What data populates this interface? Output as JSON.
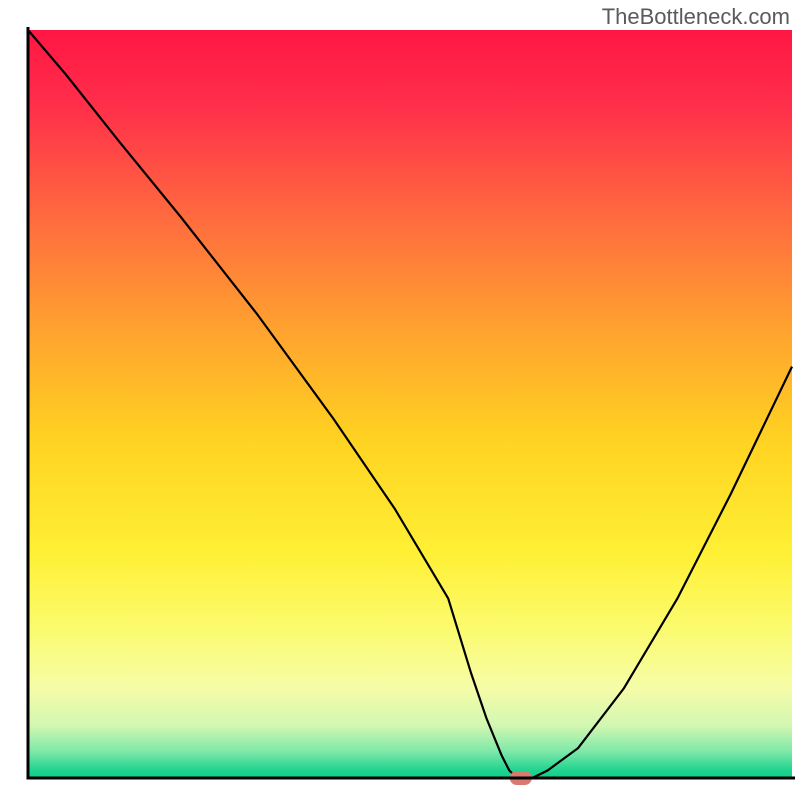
{
  "watermark": "TheBottleneck.com",
  "chart_data": {
    "type": "line",
    "title": "",
    "xlabel": "",
    "ylabel": "",
    "xlim": [
      0,
      100
    ],
    "ylim": [
      0,
      100
    ],
    "x": [
      0,
      5,
      12,
      20,
      30,
      40,
      48,
      55,
      58,
      60,
      62,
      63,
      64,
      66,
      68,
      72,
      78,
      85,
      92,
      100
    ],
    "values": [
      100,
      94,
      85,
      75,
      62,
      48,
      36,
      24,
      14,
      8,
      3,
      1,
      0,
      0,
      1,
      4,
      12,
      24,
      38,
      55
    ],
    "marker": {
      "x": 64.5,
      "y": 0,
      "color": "#d87a6f"
    },
    "gradient_stops": [
      {
        "offset": 0.0,
        "color": "#ff1744"
      },
      {
        "offset": 0.1,
        "color": "#ff2e4a"
      },
      {
        "offset": 0.25,
        "color": "#ff6a3f"
      },
      {
        "offset": 0.4,
        "color": "#ffa22f"
      },
      {
        "offset": 0.55,
        "color": "#ffd321"
      },
      {
        "offset": 0.7,
        "color": "#fff035"
      },
      {
        "offset": 0.8,
        "color": "#fbfb6e"
      },
      {
        "offset": 0.88,
        "color": "#f6fca8"
      },
      {
        "offset": 0.93,
        "color": "#d2f7b2"
      },
      {
        "offset": 0.965,
        "color": "#7de8a8"
      },
      {
        "offset": 0.99,
        "color": "#1fd38f"
      },
      {
        "offset": 1.0,
        "color": "#0fcf8a"
      }
    ],
    "axis_color": "#000000",
    "curve_color": "#000000"
  }
}
